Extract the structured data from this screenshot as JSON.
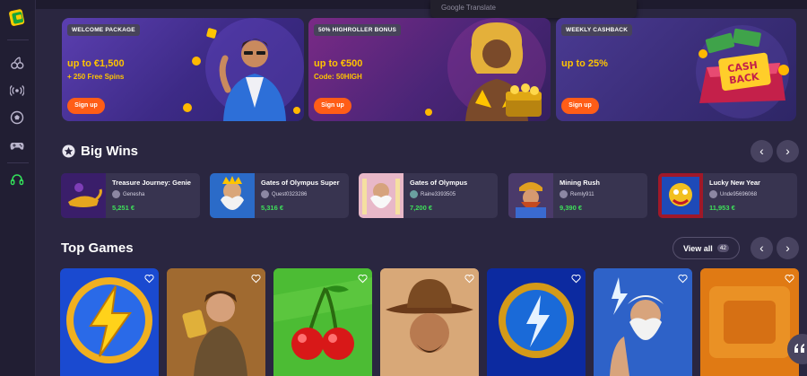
{
  "sidebar": {
    "logo": "wallet-logo-icon",
    "icons": [
      "cherries-icon",
      "live-broadcast-icon",
      "football-icon",
      "gamepad-icon",
      "headset-support-icon"
    ]
  },
  "overlay": {
    "google_translate": "Google Translate"
  },
  "promos": [
    {
      "badge": "WELCOME PACKAGE",
      "headline": "up to €1,500",
      "sub": "+ 250 Free Spins",
      "cta": "Sign up"
    },
    {
      "badge": "50% HIGHROLLER BONUS",
      "headline": "up to €500",
      "sub": "Code: 50HIGH",
      "cta": "Sign up"
    },
    {
      "badge": "WEEKLY CASHBACK",
      "headline": "up to 25%",
      "sub": "",
      "cta": "Sign up",
      "art_text": [
        "CASH",
        "BACK"
      ]
    }
  ],
  "big_wins": {
    "title": "Big Wins",
    "items": [
      {
        "game": "Treasure Journey: Genie",
        "user": "Genesha",
        "amount": "5,251 €"
      },
      {
        "game": "Gates of Olympus Super",
        "user": "Quest0323286",
        "amount": "5,316 €"
      },
      {
        "game": "Gates of Olympus",
        "user": "Raine3393505",
        "amount": "7,200 €"
      },
      {
        "game": "Mining Rush",
        "user": "Remly911",
        "amount": "9,390 €"
      },
      {
        "game": "Lucky New Year",
        "user": "Unde95696068",
        "amount": "11,953 €"
      }
    ]
  },
  "top_games": {
    "title": "Top Games",
    "view_all": "View all",
    "count": "42",
    "tiles": [
      "lightning-bolt",
      "explorer",
      "cherries",
      "cowboy",
      "blue-lightning-orb",
      "zeus",
      "orange-slot"
    ]
  },
  "colors": {
    "accent": "#ff5d17",
    "gold": "#ffc400",
    "win_green": "#3ee05a",
    "bg": "#2a2640"
  }
}
